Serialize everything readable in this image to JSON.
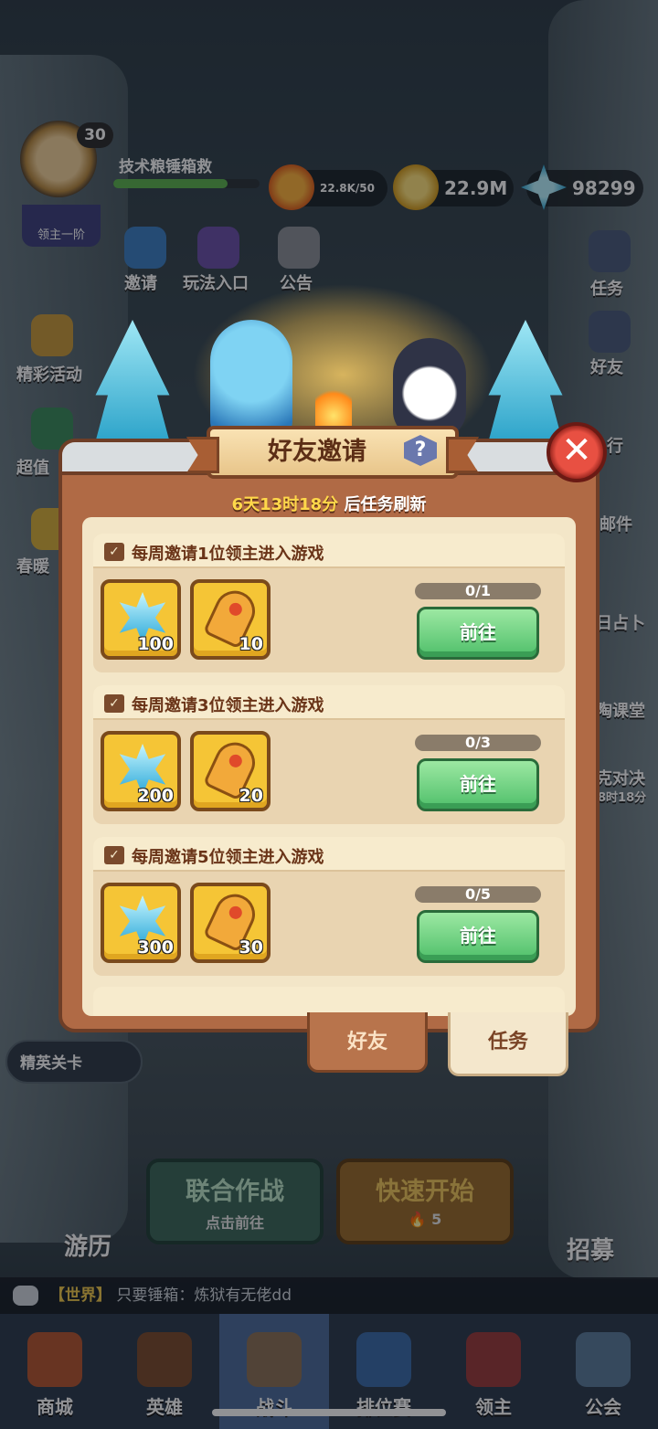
{
  "hud": {
    "level": "30",
    "rank_label": "领主一阶",
    "player_name": "技术粮锤箱救",
    "resources": [
      {
        "icon": "fire-energy-icon",
        "value": "22.8K/50"
      },
      {
        "icon": "gold-coin-icon",
        "value": "22.9M"
      },
      {
        "icon": "blue-crystal-icon",
        "value": "98299"
      }
    ],
    "xp_fraction": 0.78
  },
  "top_shortcuts": [
    "邀请",
    "玩法入口",
    "公告"
  ],
  "left_menu": [
    "精彩活动",
    "超值",
    "春暖"
  ],
  "right_menu": [
    "任务",
    "好友",
    "行",
    "邮件",
    "日占卜",
    "陶课堂",
    "克对决",
    "8时18分"
  ],
  "modal": {
    "title": "好友邀请",
    "help_label": "?",
    "close_label": "✕",
    "refresh_prefix": "6天13时18分",
    "refresh_suffix": " 后任务刷新",
    "tasks": [
      {
        "title": "每周邀请1位领主进入游戏",
        "rewards": [
          {
            "icon": "snowflake-crystal-icon",
            "amount": "100"
          },
          {
            "icon": "golden-key-icon",
            "amount": "10"
          }
        ],
        "progress_text": "0/1",
        "progress": 0,
        "button": "前往"
      },
      {
        "title": "每周邀请3位领主进入游戏",
        "rewards": [
          {
            "icon": "snowflake-crystal-icon",
            "amount": "200"
          },
          {
            "icon": "golden-key-icon",
            "amount": "20"
          }
        ],
        "progress_text": "0/3",
        "progress": 0,
        "button": "前往"
      },
      {
        "title": "每周邀请5位领主进入游戏",
        "rewards": [
          {
            "icon": "snowflake-crystal-icon",
            "amount": "300"
          },
          {
            "icon": "golden-key-icon",
            "amount": "30"
          }
        ],
        "progress_text": "0/5",
        "progress": 0,
        "button": "前往"
      }
    ],
    "tabs": [
      {
        "label": "好友",
        "active": false
      },
      {
        "label": "任务",
        "active": true
      }
    ]
  },
  "lower": {
    "elite_stage": "精英关卡",
    "coop_title": "联合作战",
    "coop_sub": "点击前往",
    "quick_title": "快速开始",
    "quick_cost": "5",
    "travel": "游历",
    "recruit": "招募"
  },
  "chat": {
    "channel": "【世界】",
    "message": "只要锤箱：炼狱有无佬dd"
  },
  "nav": [
    {
      "label": "商城",
      "active": false
    },
    {
      "label": "英雄",
      "active": false
    },
    {
      "label": "战斗",
      "active": true
    },
    {
      "label": "排位赛",
      "active": false
    },
    {
      "label": "领主",
      "active": false
    },
    {
      "label": "公会",
      "active": false
    }
  ],
  "colors": {
    "accent_green": "#4fbf6a",
    "modal_brown": "#b06a45",
    "cream": "#f3e6c8",
    "highlight_yellow": "#ffd84a"
  }
}
